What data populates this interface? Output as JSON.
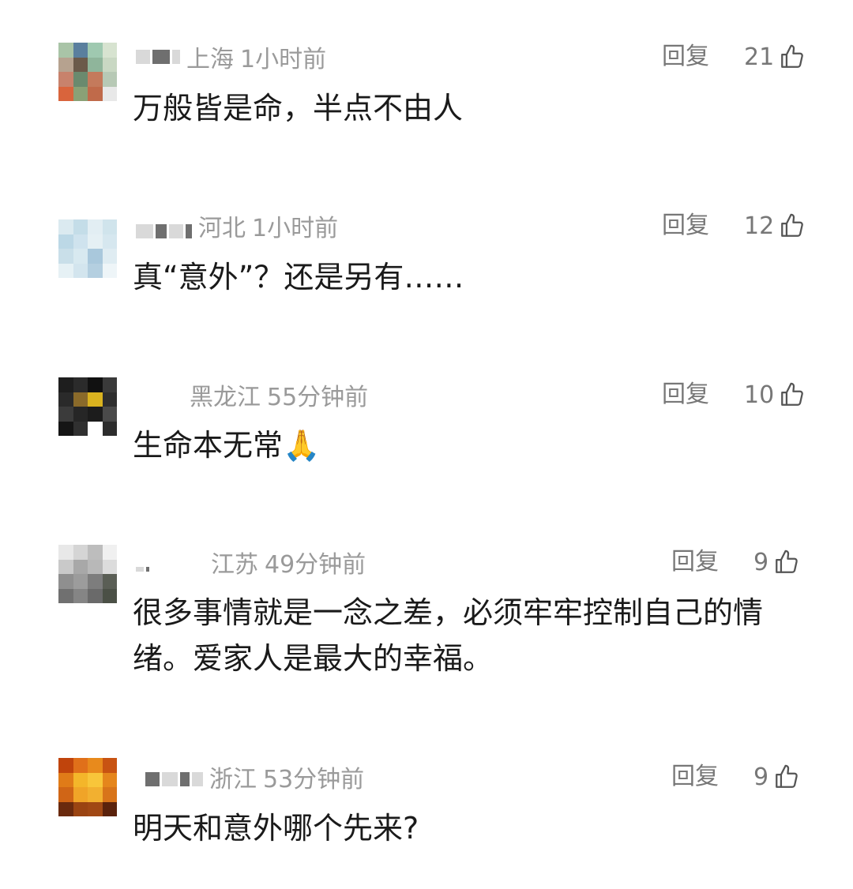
{
  "comments": [
    {
      "location": "上海",
      "time": "1小时前",
      "reply_label": "回复",
      "likes": "21",
      "text": "万般皆是命，半点不由人",
      "avatar_colors": [
        "#a9c4a7",
        "#5a7f9e",
        "#9fc9b0",
        "#d7e3d0",
        "#b6a28f",
        "#6b5a4a",
        "#8fb59b",
        "#c9d8c3",
        "#c8826c",
        "#6a8a6e",
        "#c47a5c",
        "#b7c9b5",
        "#d9643c",
        "#8aa176",
        "#c06a4a",
        "#e8e8e8"
      ],
      "thumb_icon": "thumb-up-icon"
    },
    {
      "location": "河北",
      "time": "1小时前",
      "reply_label": "回复",
      "likes": "12",
      "text": "真“意外”？还是另有……",
      "avatar_colors": [
        "#dbeaf0",
        "#c4dde8",
        "#e2eef3",
        "#d0e4ec",
        "#bcd8e6",
        "#cfe3ee",
        "#e5f0f4",
        "#d6e7ef",
        "#c9dfe9",
        "#d8e9f0",
        "#a9c8dc",
        "#dfecf2",
        "#e6f1f5",
        "#d3e5ee",
        "#b4cfe0",
        "#eef5f8"
      ],
      "thumb_icon": "thumb-up-icon"
    },
    {
      "location": "黑龙江",
      "time": "55分钟前",
      "reply_label": "回复",
      "likes": "10",
      "text": "生命本无常🙏",
      "avatar_colors": [
        "#1e1e1e",
        "#2b2b2b",
        "#111111",
        "#3a3a3a",
        "#2a2a2a",
        "#8a6a2a",
        "#d9b21f",
        "#2e2e2e",
        "#3b3b3b",
        "#262626",
        "#1c1c1c",
        "#4a4a4a",
        "#151515",
        "#303030",
        "#ffffff",
        "#2d2d2d"
      ],
      "thumb_icon": "thumb-up-icon"
    },
    {
      "location": "江苏",
      "time": "49分钟前",
      "reply_label": "回复",
      "likes": "9",
      "text": "很多事情就是一念之差，必须牢牢控制自己的情绪。爱家人是最大的幸福。",
      "avatar_colors": [
        "#e8e8e8",
        "#d5d5d5",
        "#bdbdbd",
        "#f0f0f0",
        "#c9c9c9",
        "#a8a8a8",
        "#b8b8b8",
        "#dcdcdc",
        "#8f8f8f",
        "#9c9c9c",
        "#7d7d7d",
        "#5a5e55",
        "#707070",
        "#858585",
        "#6a6a6a",
        "#4b5046"
      ],
      "thumb_icon": "thumb-up-icon"
    },
    {
      "location": "浙江",
      "time": "53分钟前",
      "reply_label": "回复",
      "likes": "9",
      "text": "明天和意外哪个先来?",
      "avatar_colors": [
        "#c0440c",
        "#e0701a",
        "#e88a1c",
        "#c85312",
        "#e07b18",
        "#f4b62a",
        "#f8c63a",
        "#e5861c",
        "#d06516",
        "#f0a428",
        "#f2b030",
        "#d8741a",
        "#6a2a0e",
        "#9a4412",
        "#a04814",
        "#5a220c"
      ],
      "thumb_icon": "thumb-up-icon"
    }
  ]
}
